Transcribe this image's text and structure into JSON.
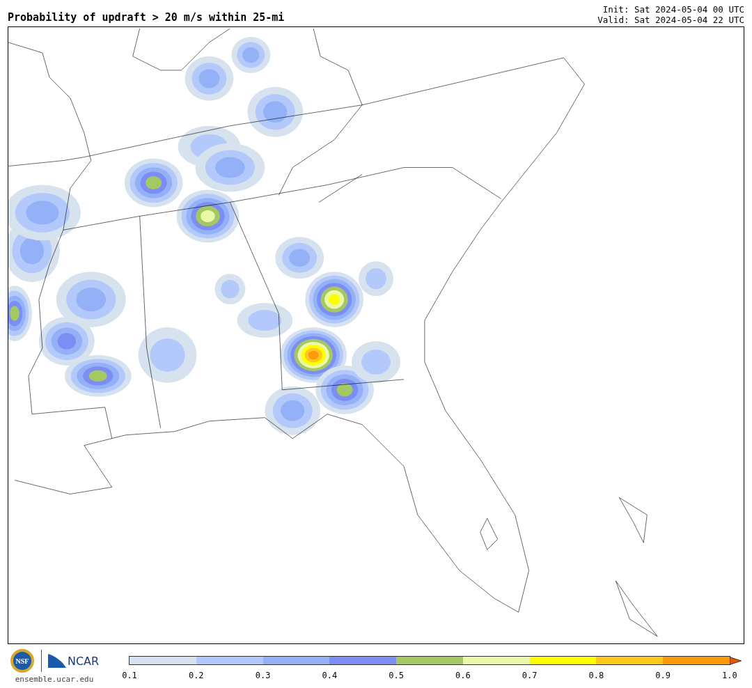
{
  "title": "Probability of updraft > 20 m/s within 25-mi",
  "init": "Init: Sat 2024-05-04 00 UTC",
  "valid": "Valid: Sat 2024-05-04 22 UTC",
  "logos": {
    "nsf": "NSF",
    "ncar": "NCAR",
    "url": "ensemble.ucar.edu"
  },
  "colorbar": {
    "segments": [
      {
        "color": "#d6e2ee"
      },
      {
        "color": "#b4c9fb"
      },
      {
        "color": "#94b1f8"
      },
      {
        "color": "#7c8ef4"
      },
      {
        "color": "#a4c964"
      },
      {
        "color": "#eaf8a8"
      },
      {
        "color": "#fefe00"
      },
      {
        "color": "#fec81c"
      },
      {
        "color": "#fd9a0c"
      },
      {
        "kind": "extend_arrow",
        "color": "#e8560a"
      }
    ],
    "ticks": [
      "0.1",
      "0.2",
      "0.3",
      "0.4",
      "0.5",
      "0.6",
      "0.7",
      "0.8",
      "0.9",
      "1.0"
    ]
  }
}
